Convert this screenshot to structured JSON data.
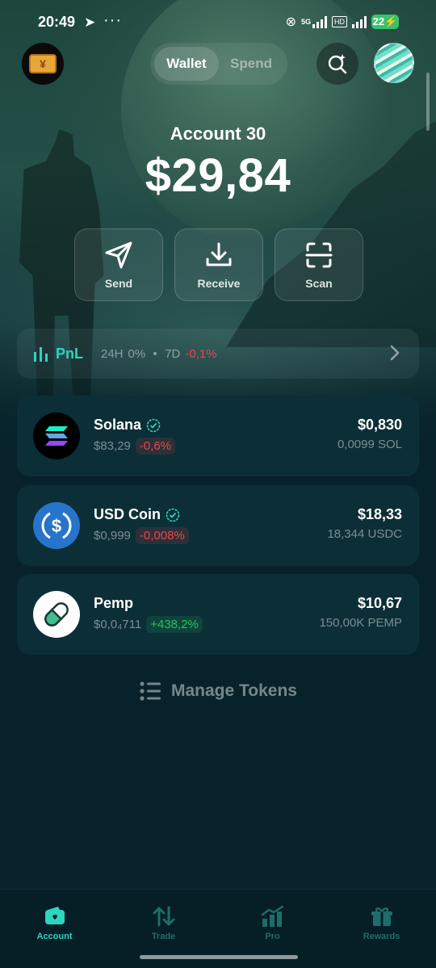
{
  "status_bar": {
    "time": "20:49",
    "network": "5G",
    "volte": "HD",
    "battery": "22"
  },
  "header": {
    "segments": [
      "Wallet",
      "Spend"
    ],
    "active_segment": "Wallet"
  },
  "account": {
    "name": "Account 30",
    "balance": "$29,84"
  },
  "actions": {
    "send": "Send",
    "receive": "Receive",
    "scan": "Scan"
  },
  "pnl": {
    "label": "PnL",
    "p24h_label": "24H",
    "p24h_value": "0%",
    "p7d_label": "7D",
    "p7d_value": "-0,1%"
  },
  "tokens": [
    {
      "name": "Solana",
      "verified": true,
      "price": "$83,29",
      "change": "-0,6%",
      "change_dir": "neg",
      "value": "$0,830",
      "qty": "0,0099 SOL"
    },
    {
      "name": "USD Coin",
      "verified": true,
      "price": "$0,999",
      "change": "-0,008%",
      "change_dir": "neg",
      "value": "$18,33",
      "qty": "18,344 USDC"
    },
    {
      "name": "Pemp",
      "verified": false,
      "price": "$0,0₄711",
      "change": "+438,2%",
      "change_dir": "pos",
      "value": "$10,67",
      "qty": "150,00K PEMP"
    }
  ],
  "manage_tokens": "Manage Tokens",
  "tabs": [
    {
      "label": "Account",
      "icon": "wallet-icon",
      "active": true
    },
    {
      "label": "Trade",
      "icon": "arrows-icon",
      "active": false
    },
    {
      "label": "Pro",
      "icon": "chart-icon",
      "active": false
    },
    {
      "label": "Rewards",
      "icon": "gift-icon",
      "active": false
    }
  ],
  "colors": {
    "accent": "#2dd4bf",
    "negative": "#ef4444",
    "positive": "#22c55e",
    "background": "#07222a",
    "card": "#0c2e37"
  }
}
